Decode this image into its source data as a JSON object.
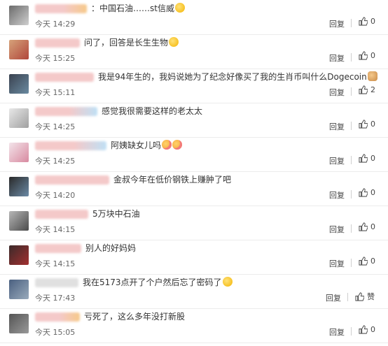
{
  "comments": [
    {
      "text": "：中国石油……st信威",
      "emoji": "laugh",
      "time": "今天 14:29",
      "reply": "回复",
      "likes": "0"
    },
    {
      "text": "问了，回答是长生生物",
      "emoji": "laugh",
      "time": "今天 15:25",
      "reply": "回复",
      "likes": "0"
    },
    {
      "text": "我是94年生的，我妈说她为了纪念好像买了我的生肖币叫什么Dogecoin",
      "emoji": "dog",
      "time": "今天 15:11",
      "reply": "回复",
      "likes": "2"
    },
    {
      "text": "感觉我很需要这样的老太太",
      "emoji": "",
      "time": "今天 14:25",
      "reply": "回复",
      "likes": "0"
    },
    {
      "text": "阿姨缺女儿吗",
      "emoji": "blush2",
      "time": "今天 14:25",
      "reply": "回复",
      "likes": "0"
    },
    {
      "text": "金叔今年在低价钢铁上赚肿了吧",
      "emoji": "",
      "time": "今天 14:20",
      "reply": "回复",
      "likes": "0"
    },
    {
      "text": "5万块中石油",
      "emoji": "",
      "time": "今天 14:15",
      "reply": "回复",
      "likes": "0"
    },
    {
      "text": "别人的好妈妈",
      "emoji": "",
      "time": "今天 14:15",
      "reply": "回复",
      "likes": "0"
    },
    {
      "text": "我在5173点开了个户然后忘了密码了",
      "emoji": "laugh",
      "time": "今天 17:43",
      "reply": "回复",
      "likes": "赞"
    },
    {
      "text": "亏死了，这么多年没打新股",
      "emoji": "",
      "time": "今天 15:05",
      "reply": "回复",
      "likes": "0"
    }
  ],
  "colors": {
    "text": "#333333",
    "meta": "#666666",
    "divider": "#ececec",
    "blur_pink": "#f4c9c9",
    "blur_orange": "#f6c98a",
    "blur_blue": "#bfe0f5"
  }
}
